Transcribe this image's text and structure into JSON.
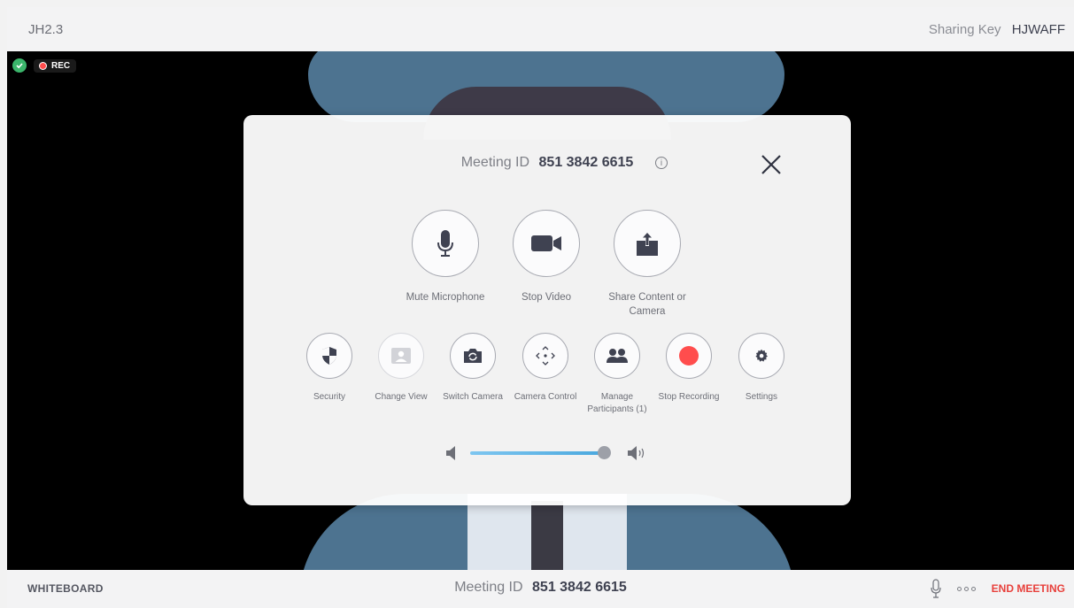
{
  "topbar": {
    "room_name": "JH2.3",
    "sharing_key_label": "Sharing Key",
    "sharing_key_value": "HJWAFF"
  },
  "status": {
    "secure_icon": "shield-check-icon",
    "rec_label": "REC"
  },
  "panel": {
    "meeting_id_label": "Meeting ID",
    "meeting_id_value": "851 3842 6615",
    "info_icon": "info-icon",
    "close_icon": "close-icon",
    "primary_actions": [
      {
        "label": "Mute Microphone",
        "icon": "microphone-icon"
      },
      {
        "label": "Stop Video",
        "icon": "video-camera-icon"
      },
      {
        "label": "Share Content or Camera",
        "icon": "share-upload-icon"
      }
    ],
    "secondary_actions": [
      {
        "label": "Security",
        "icon": "shield-icon"
      },
      {
        "label": "Change View",
        "icon": "change-view-icon",
        "disabled": true
      },
      {
        "label": "Switch Camera",
        "icon": "switch-camera-icon"
      },
      {
        "label": "Camera Control",
        "icon": "camera-control-icon"
      },
      {
        "label": "Manage Participants (1)",
        "icon": "participants-icon"
      },
      {
        "label": "Stop Recording",
        "icon": "record-icon"
      },
      {
        "label": "Settings",
        "icon": "gear-icon"
      }
    ],
    "volume": {
      "level": 0.95,
      "low_icon": "speaker-low-icon",
      "high_icon": "speaker-high-icon"
    }
  },
  "bottombar": {
    "whiteboard_label": "WHITEBOARD",
    "meeting_id_label": "Meeting ID",
    "meeting_id_value": "851 3842 6615",
    "mic_icon": "microphone-icon",
    "more_icon": "more-dots-icon",
    "end_meeting_label": "END MEETING"
  },
  "colors": {
    "accent_blue": "#4aa8de",
    "record_red": "#ff4d4d",
    "end_meeting_red": "#e8413c",
    "secure_green": "#3bb56b"
  }
}
